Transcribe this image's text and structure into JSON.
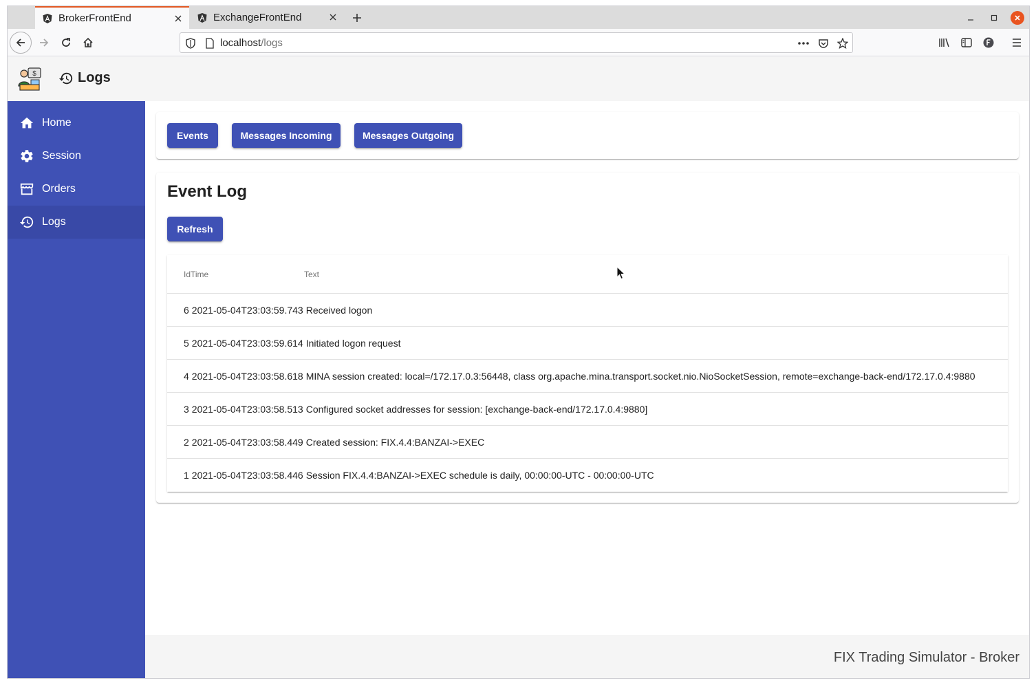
{
  "browser": {
    "tabs": [
      {
        "title": "BrokerFrontEnd",
        "active": true
      },
      {
        "title": "ExchangeFrontEnd",
        "active": false
      }
    ],
    "url_host": "localhost",
    "url_path": "/logs"
  },
  "header": {
    "title": "Logs"
  },
  "sidebar": {
    "items": [
      {
        "label": "Home",
        "icon": "home-icon"
      },
      {
        "label": "Session",
        "icon": "gear-icon"
      },
      {
        "label": "Orders",
        "icon": "store-icon"
      },
      {
        "label": "Logs",
        "icon": "history-icon",
        "active": true
      }
    ]
  },
  "log_tabs": {
    "events": "Events",
    "incoming": "Messages Incoming",
    "outgoing": "Messages Outgoing"
  },
  "event_log": {
    "title": "Event Log",
    "refresh_label": "Refresh",
    "columns": [
      "IdTime",
      "Text"
    ],
    "rows": [
      {
        "id": "6",
        "time": "2021-05-04T23:03:59.743",
        "text": "Received logon"
      },
      {
        "id": "5",
        "time": "2021-05-04T23:03:59.614",
        "text": "Initiated logon request"
      },
      {
        "id": "4",
        "time": "2021-05-04T23:03:58.618",
        "text": "MINA session created: local=/172.17.0.3:56448, class org.apache.mina.transport.socket.nio.NioSocketSession, remote=exchange-back-end/172.17.0.4:9880"
      },
      {
        "id": "3",
        "time": "2021-05-04T23:03:58.513",
        "text": "Configured socket addresses for session: [exchange-back-end/172.17.0.4:9880]"
      },
      {
        "id": "2",
        "time": "2021-05-04T23:03:58.449",
        "text": "Created session: FIX.4.4:BANZAI->EXEC"
      },
      {
        "id": "1",
        "time": "2021-05-04T23:03:58.446",
        "text": "Session FIX.4.4:BANZAI->EXEC schedule is daily, 00:00:00-UTC - 00:00:00-UTC"
      }
    ]
  },
  "footer": {
    "text": "FIX Trading Simulator - Broker"
  },
  "colors": {
    "primary": "#3f51b5",
    "tab_accent": "#e25822",
    "window_close": "#e95420"
  }
}
